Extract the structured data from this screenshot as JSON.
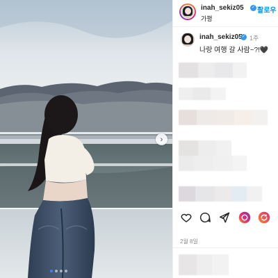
{
  "post": {
    "username": "inah_sekiz05",
    "separator": "•",
    "follow_label": "팔로우",
    "location": "가평",
    "caption": "나랑 여행 갈 사람~?!🖤",
    "time_ago": "1주",
    "date": "2월 8일"
  },
  "carousel": {
    "total": 4,
    "active_index": 0
  },
  "icons": {
    "verified": "verified-badge-icon",
    "next": "chevron-right-icon",
    "like": "heart-icon",
    "comment": "comment-icon",
    "share": "send-icon",
    "app1": "circle-app-icon",
    "app2": "refresh-app-icon"
  },
  "colors": {
    "accent": "#0095f6",
    "verified": "#3797f0",
    "muted_text": "#8e8e8e",
    "active_dot": "#3b82f6",
    "app_gradient_start": "#f58529",
    "app_gradient_end": "#dd2a7b"
  }
}
